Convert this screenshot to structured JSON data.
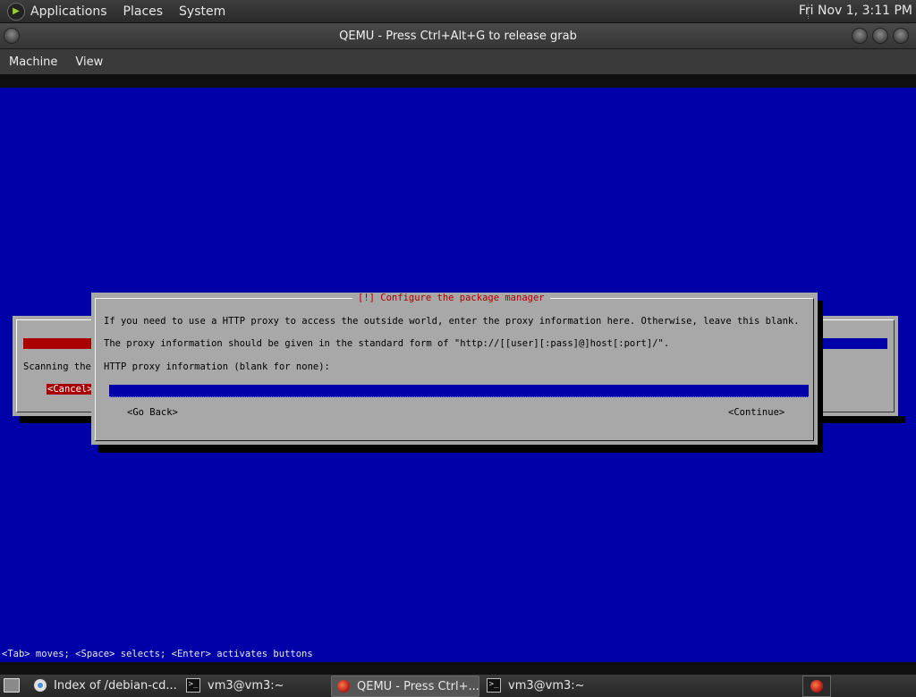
{
  "top_panel": {
    "menus": [
      "Applications",
      "Places",
      "System"
    ],
    "clock": "Fri Nov  1,  3:11 PM"
  },
  "window": {
    "title": "QEMU - Press Ctrl+Alt+G to release grab",
    "menu": [
      "Machine",
      "View"
    ]
  },
  "guest": {
    "background_dialog": {
      "scanning_text": "Scanning the",
      "cancel_label": "<Cancel>"
    },
    "dialog": {
      "title": "[!] Configure the package manager",
      "line1": "If you need to use a HTTP proxy to access the outside world, enter the proxy information here. Otherwise, leave this blank.",
      "line2": "The proxy information should be given in the standard form of \"http://[[user][:pass]@]host[:port]/\".",
      "field_label": "HTTP proxy information (blank for none):",
      "field_value": "",
      "go_back_label": "<Go Back>",
      "continue_label": "<Continue>"
    },
    "help_line": "<Tab> moves; <Space> selects; <Enter> activates buttons",
    "colors": {
      "screen": "#0000a8",
      "dialog": "#a8a8a8",
      "title": "#a80000"
    }
  },
  "taskbar": {
    "tasks": [
      {
        "label": "Index of /debian-cd...",
        "icon": "chrome-icon"
      },
      {
        "label": "vm3@vm3:~",
        "icon": "terminal-icon"
      },
      {
        "label": "QEMU - Press Ctrl+...",
        "icon": "qemu-icon",
        "active": true
      },
      {
        "label": "vm3@vm3:~",
        "icon": "terminal-icon"
      }
    ]
  }
}
